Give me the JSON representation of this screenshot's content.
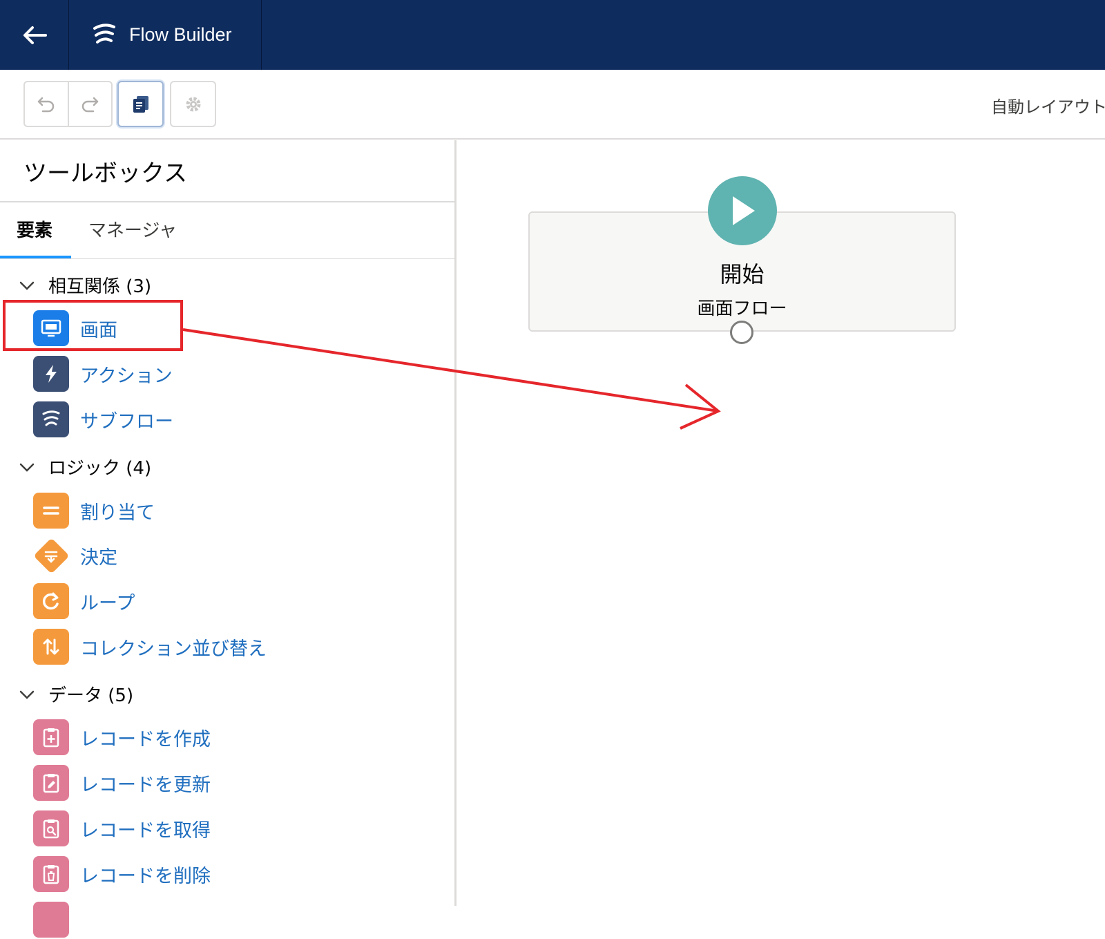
{
  "header": {
    "title": "Flow Builder",
    "background": "#0f2c5e"
  },
  "toolbar": {
    "undo_icon": "undo-icon",
    "redo_icon": "redo-icon",
    "properties_icon": "document-icon",
    "settings_icon": "gear-icon",
    "auto_layout_label": "自動レイアウト"
  },
  "toolbox": {
    "title": "ツールボックス",
    "tabs": [
      {
        "label": "要素",
        "selected": true
      },
      {
        "label": "マネージャ",
        "selected": false
      }
    ],
    "sections": [
      {
        "label": "相互関係 (3)",
        "items": [
          {
            "label": "画面",
            "icon": "screen-icon",
            "color": "#1b7ee8"
          },
          {
            "label": "アクション",
            "icon": "lightning-icon",
            "color": "#3b4f74"
          },
          {
            "label": "サブフロー",
            "icon": "flow-icon",
            "color": "#3b4f74"
          }
        ]
      },
      {
        "label": "ロジック (4)",
        "items": [
          {
            "label": "割り当て",
            "icon": "equals-icon",
            "color": "#f59a3c"
          },
          {
            "label": "決定",
            "icon": "decision-icon",
            "color": "#f59a3c"
          },
          {
            "label": "ループ",
            "icon": "loop-icon",
            "color": "#f59a3c"
          },
          {
            "label": "コレクション並び替え",
            "icon": "sort-icon",
            "color": "#f59a3c"
          }
        ]
      },
      {
        "label": "データ (5)",
        "items": [
          {
            "label": "レコードを作成",
            "icon": "record-create-icon",
            "color": "#e07b95"
          },
          {
            "label": "レコードを更新",
            "icon": "record-update-icon",
            "color": "#e07b95"
          },
          {
            "label": "レコードを取得",
            "icon": "record-lookup-icon",
            "color": "#e07b95"
          },
          {
            "label": "レコードを削除",
            "icon": "record-delete-icon",
            "color": "#e07b95"
          }
        ]
      }
    ]
  },
  "canvas": {
    "start_title": "開始",
    "start_subtitle": "画面フロー",
    "start_color": "#5fb3b0"
  },
  "annotation": {
    "color": "#e5262b"
  }
}
